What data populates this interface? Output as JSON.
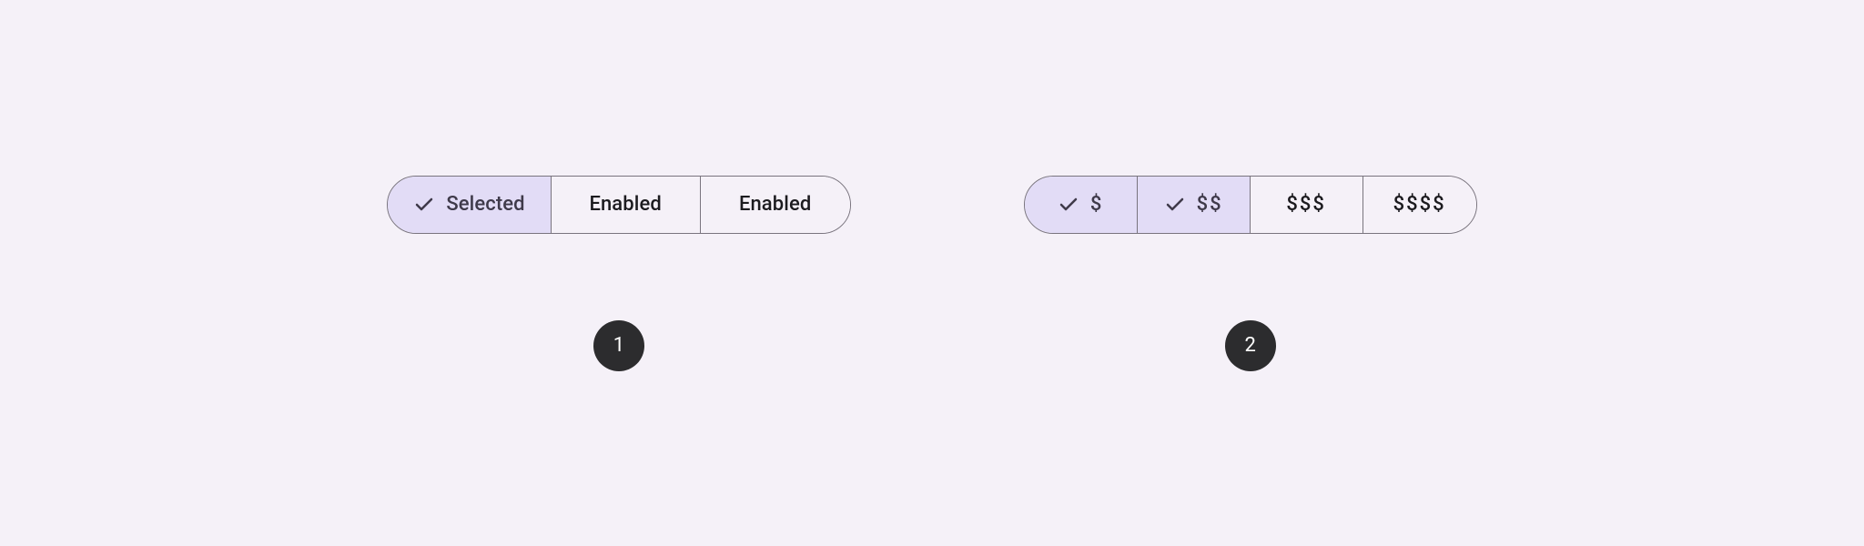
{
  "example1": {
    "segments": [
      {
        "label": "Selected",
        "selected": true
      },
      {
        "label": "Enabled",
        "selected": false
      },
      {
        "label": "Enabled",
        "selected": false
      }
    ],
    "badge": "1"
  },
  "example2": {
    "segments": [
      {
        "label": "$",
        "selected": true
      },
      {
        "label": "$$",
        "selected": true
      },
      {
        "label": "$$$",
        "selected": false
      },
      {
        "label": "$$$$",
        "selected": false
      }
    ],
    "badge": "2"
  }
}
